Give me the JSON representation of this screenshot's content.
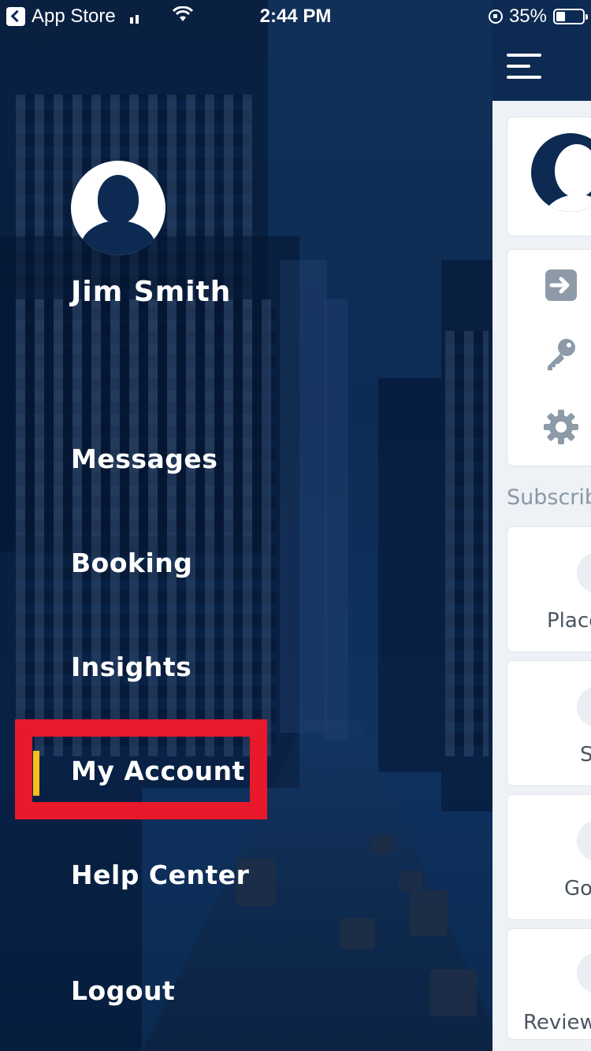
{
  "status_bar": {
    "back_app": "App Store",
    "time": "2:44 PM",
    "battery": "35%",
    "battery_level": 0.35
  },
  "drawer": {
    "user_name": "Jim Smith",
    "menu": [
      {
        "label": "Messages",
        "active": false
      },
      {
        "label": "Booking",
        "active": false
      },
      {
        "label": "Insights",
        "active": false
      },
      {
        "label": "My Account",
        "active": true
      },
      {
        "label": "Help Center",
        "active": false
      },
      {
        "label": "Logout",
        "active": false
      }
    ]
  },
  "main_peek": {
    "section_title": "Subscrib",
    "services": [
      "Place",
      "S",
      "Go",
      "Review"
    ]
  },
  "colors": {
    "navy": "#0c2a52",
    "highlight_red": "#e8192a",
    "active_yellow": "#f5c11a",
    "icon_gray": "#8d9aa8"
  },
  "icons": [
    "back-icon",
    "signal-icon",
    "wifi-icon",
    "rotation-lock-icon",
    "battery-icon",
    "hamburger-icon",
    "avatar-icon",
    "login-icon",
    "key-icon",
    "gear-icon"
  ]
}
